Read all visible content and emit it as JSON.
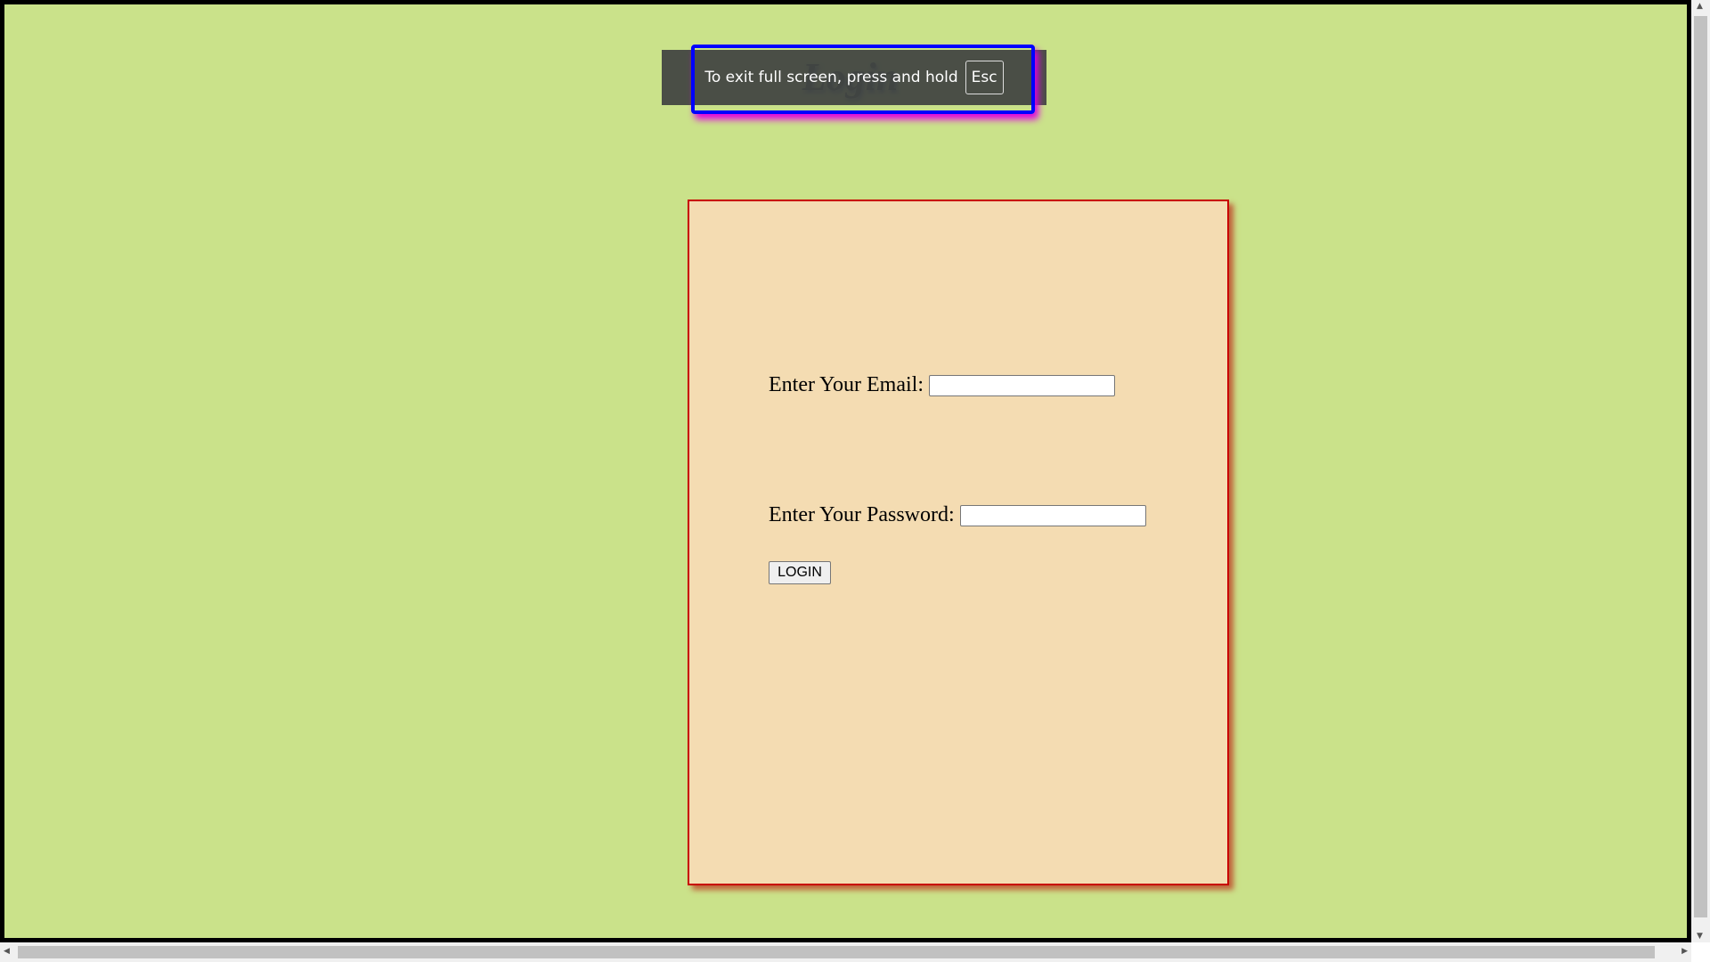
{
  "page": {
    "heading": "Login"
  },
  "form": {
    "email_label": "Enter Your Email:",
    "email_value": "",
    "password_label": "Enter Your Password:",
    "password_value": "",
    "login_button": "LOGIN"
  },
  "fullscreen_toast": {
    "message": "To exit full screen, press and hold",
    "key": "Esc"
  },
  "colors": {
    "background": "#cae28a",
    "panel": "#f4dcb2",
    "panel_border": "#c80000"
  }
}
